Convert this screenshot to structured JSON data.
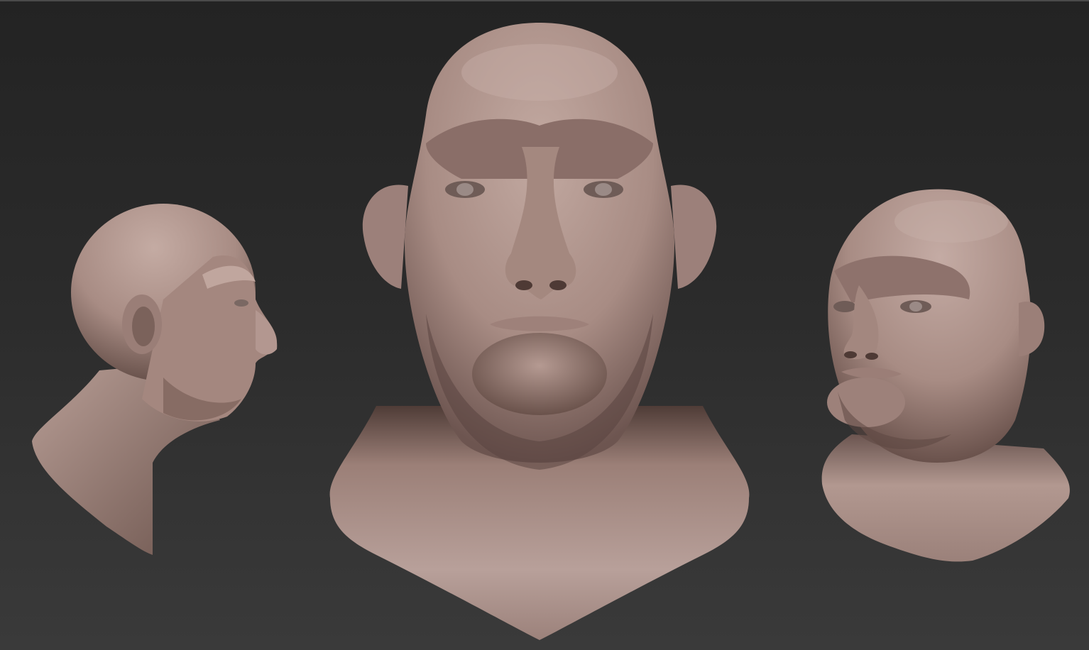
{
  "scene": {
    "background": "#2a2a2a",
    "skin_color": "#a88c84",
    "skin_highlight": "#c8aea6",
    "skin_shadow": "#5e4842",
    "views": [
      {
        "name": "side"
      },
      {
        "name": "front"
      },
      {
        "name": "three-quarter"
      }
    ]
  }
}
